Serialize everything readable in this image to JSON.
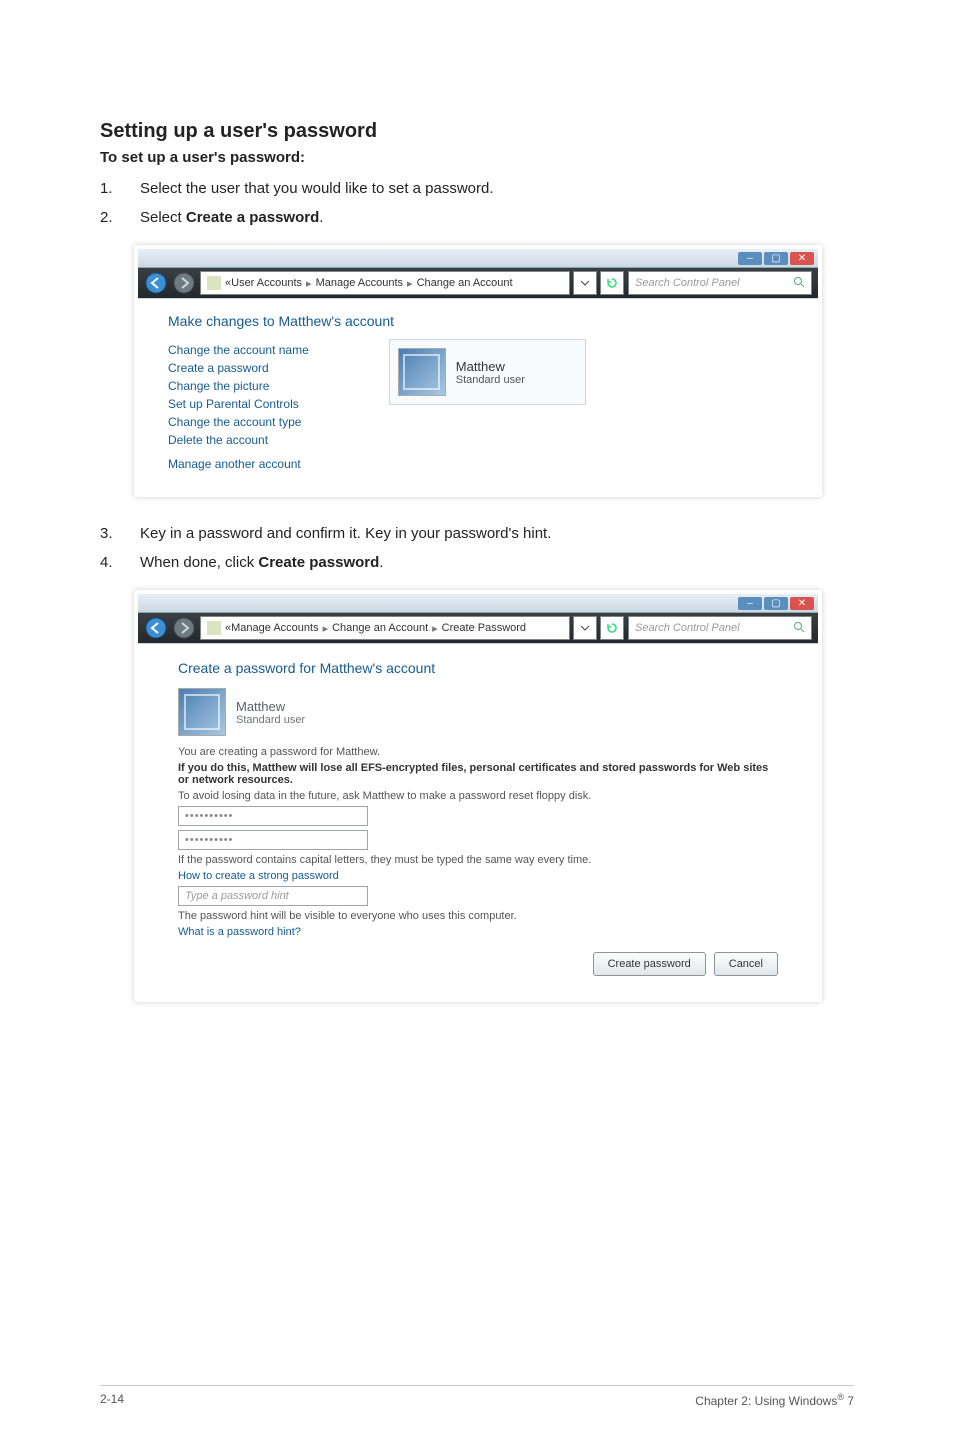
{
  "heading": "Setting up a user's password",
  "subheading": "To set up a user's password:",
  "steps_a": [
    {
      "n": "1.",
      "text": "Select the user that you would like to set a password."
    },
    {
      "n": "2.",
      "text_pre": "Select ",
      "strong": "Create a password",
      "text_post": "."
    }
  ],
  "steps_b": [
    {
      "n": "3.",
      "text": "Key in a password and confirm it. Key in your password's hint."
    },
    {
      "n": "4.",
      "text_pre": "When done, click ",
      "strong": "Create password",
      "text_post": "."
    }
  ],
  "shot1": {
    "breadcrumbs": [
      "User Accounts",
      "Manage Accounts",
      "Change an Account"
    ],
    "search_placeholder": "Search Control Panel",
    "pane_title": "Make changes to Matthew's account",
    "links": [
      "Change the account name",
      "Create a password",
      "Change the picture",
      "Set up Parental Controls",
      "Change the account type",
      "Delete the account",
      "Manage another account"
    ],
    "account_name": "Matthew",
    "account_type": "Standard user"
  },
  "shot2": {
    "breadcrumbs": [
      "Manage Accounts",
      "Change an Account",
      "Create Password"
    ],
    "search_placeholder": "Search Control Panel",
    "pane_title": "Create a password for Matthew's account",
    "user_name": "Matthew",
    "user_type": "Standard user",
    "creating_text": "You are creating a password for Matthew.",
    "warning_text": "If you do this, Matthew will lose all EFS-encrypted files, personal certificates and stored passwords for Web sites or network resources.",
    "avoid_text": "To avoid losing data in the future, ask Matthew to make a password reset floppy disk.",
    "pw_value1": "••••••••••",
    "pw_value2": "••••••••••",
    "caps_note": "If the password contains capital letters, they must be typed the same way every time.",
    "strong_link": "How to create a strong password",
    "hint_placeholder": "Type a password hint",
    "hint_note": "The password hint will be visible to everyone who uses this computer.",
    "hint_link": "What is a password hint?",
    "btn_create": "Create password",
    "btn_cancel": "Cancel"
  },
  "footer": {
    "left": "2-14",
    "right_pre": "Chapter 2: Using Windows",
    "right_sup": "®",
    "right_post": " 7"
  }
}
